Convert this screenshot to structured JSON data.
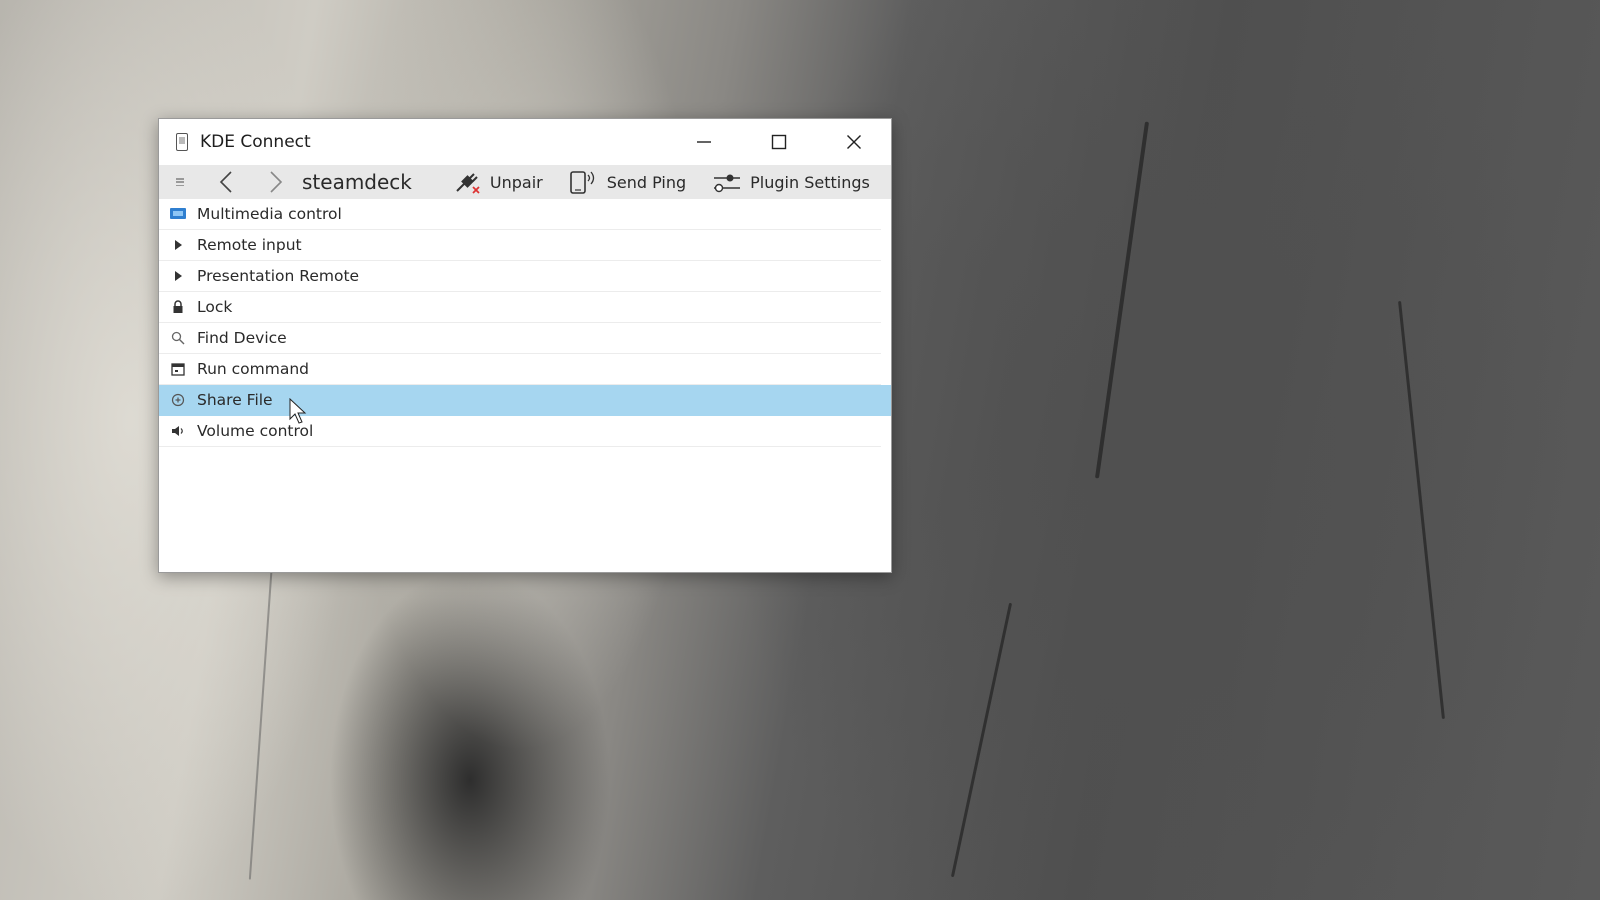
{
  "window": {
    "title": "KDE Connect",
    "icon": "phone-icon"
  },
  "toolbar": {
    "device_name": "steamdeck",
    "unpair_label": "Unpair",
    "send_ping_label": "Send Ping",
    "plugin_settings_label": "Plugin Settings"
  },
  "plugins": [
    {
      "label": "Multimedia control",
      "icon": "multimedia-icon"
    },
    {
      "label": "Remote input",
      "icon": "pointer-icon"
    },
    {
      "label": "Presentation Remote",
      "icon": "pointer-icon"
    },
    {
      "label": "Lock",
      "icon": "lock-icon"
    },
    {
      "label": "Find Device",
      "icon": "search-icon"
    },
    {
      "label": "Run command",
      "icon": "terminal-icon"
    },
    {
      "label": "Share File",
      "icon": "share-icon",
      "selected": true
    },
    {
      "label": "Volume control",
      "icon": "speaker-icon"
    }
  ],
  "colors": {
    "selection": "#a6d6f0",
    "toolbar_bg": "#e8e8e8"
  }
}
